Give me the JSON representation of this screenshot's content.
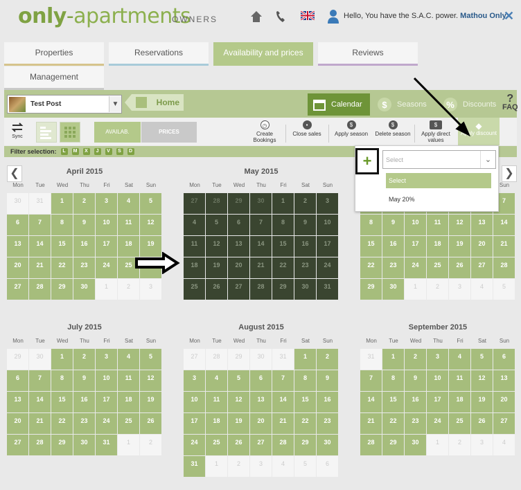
{
  "brand": {
    "bold": "only",
    "dash": "-",
    "rest": "apartments",
    "suffix": "OWNERS"
  },
  "header": {
    "hello": "Hello, You have the S.A.C. power.",
    "user": "Mathou Only",
    "close": "✕"
  },
  "tabs": [
    {
      "label": "Properties",
      "color": "#d6c48c"
    },
    {
      "label": "Reservations",
      "color": "#a8cbd9"
    },
    {
      "label": "Availability and prices",
      "color": "#b4c98a"
    },
    {
      "label": "Reviews",
      "color": "#c0a8cc"
    },
    {
      "label": "Management",
      "color": "#c9c9c9"
    }
  ],
  "property_select": {
    "value": "Test Post"
  },
  "home_label": "Home",
  "right_tabs": {
    "calendar": "Calendar",
    "seasons": "Seasons",
    "discounts": "Discounts",
    "faq": "FAQ"
  },
  "toolbar": {
    "sync": "Sync",
    "avail": "AVAILAB.",
    "prices": "PRICES",
    "create": "Create Bookings",
    "close_sales": "Close sales",
    "apply_season": "Apply season",
    "delete_season": "Delete season",
    "apply_direct": "Apply direct values",
    "apply_discount": "Apply discount"
  },
  "filter": {
    "label": "Filter selection:",
    "days": [
      "L",
      "M",
      "X",
      "J",
      "V",
      "S",
      "D"
    ]
  },
  "nav": {
    "prev": "❮",
    "next": "❯"
  },
  "dow": [
    "Mon",
    "Tue",
    "Wed",
    "Thu",
    "Fri",
    "Sat",
    "Sun"
  ],
  "months": [
    {
      "title": "April 2015",
      "lead": [
        30,
        31
      ],
      "days": 30,
      "tail": [
        1,
        2,
        3
      ],
      "dark": false
    },
    {
      "title": "May 2015",
      "lead": [
        27,
        28,
        29,
        30
      ],
      "days": 31,
      "tail": [],
      "dark": true
    },
    {
      "title": "",
      "lead": [],
      "days": 0,
      "tail": [],
      "dark": false
    },
    {
      "title": "July 2015",
      "lead": [
        29,
        30
      ],
      "days": 31,
      "tail": [
        1,
        2
      ],
      "dark": false
    },
    {
      "title": "August 2015",
      "lead": [
        27,
        28,
        29,
        30,
        31
      ],
      "days": 31,
      "tail": [
        1,
        2,
        3,
        4,
        5,
        6
      ],
      "dark": false
    },
    {
      "title": "September 2015",
      "lead": [
        31
      ],
      "days": 30,
      "tail": [
        1,
        2,
        3,
        4
      ],
      "dark": false
    }
  ],
  "partial_june": {
    "rows": [
      [
        1,
        2,
        3,
        4,
        5,
        6,
        7
      ],
      [
        8,
        9,
        10,
        11,
        12,
        13,
        14
      ],
      [
        15,
        16,
        17,
        18,
        19,
        20,
        21
      ],
      [
        22,
        23,
        24,
        25,
        26,
        27,
        28
      ],
      [
        29,
        30,
        1,
        2,
        3,
        4,
        5
      ]
    ]
  },
  "discount_dropdown": {
    "plus": "+",
    "placeholder": "Select",
    "options": [
      "Select",
      "May 20%"
    ]
  }
}
